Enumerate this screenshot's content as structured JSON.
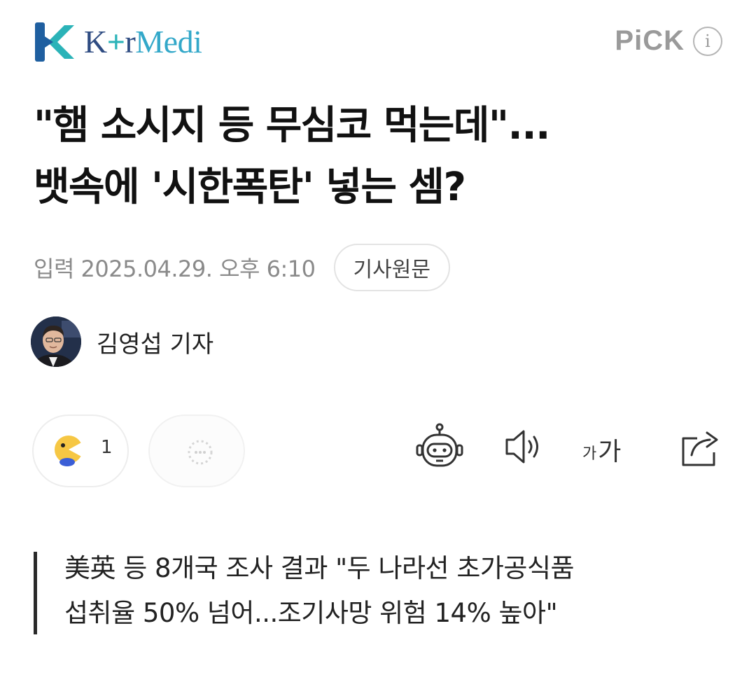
{
  "header": {
    "logo_icon": "kormedi-k-logo-icon",
    "logo_part1": "K",
    "logo_plus": "+",
    "logo_part2": "r",
    "logo_part3": "Medi",
    "pick_label": "PiCK",
    "info_icon": "i",
    "colors": {
      "logo_navy": "#2f4c82",
      "logo_teal": "#2bb3b8",
      "logo_blue": "#33a8c9",
      "pick_gray": "#9a9a9a"
    }
  },
  "article": {
    "title_line1": "\"햄 소시지 등 무심코 먹는데\"...",
    "title_line2": "뱃속에 '시한폭탄' 넣는 셈?",
    "date": "입력 2025.04.29. 오후 6:10",
    "original_button": "기사원문",
    "reporter_name": "김영섭 기자",
    "subtitle_line1": "美英 등 8개국 조사 결과 \"두 나라선 초가공식품",
    "subtitle_line2": "섭취율 50% 넘어...조기사망 위험 14% 높아\""
  },
  "reactions": {
    "pill1_icon": "emoji-reaction-icon",
    "pill1_count": "1",
    "pill2_icon": "comment-icon"
  },
  "toolbar": {
    "robot_icon": "ai-summary-robot-icon",
    "sound_icon": "speaker-icon",
    "font_small": "가",
    "font_large": "가",
    "share_icon": "share-icon"
  }
}
